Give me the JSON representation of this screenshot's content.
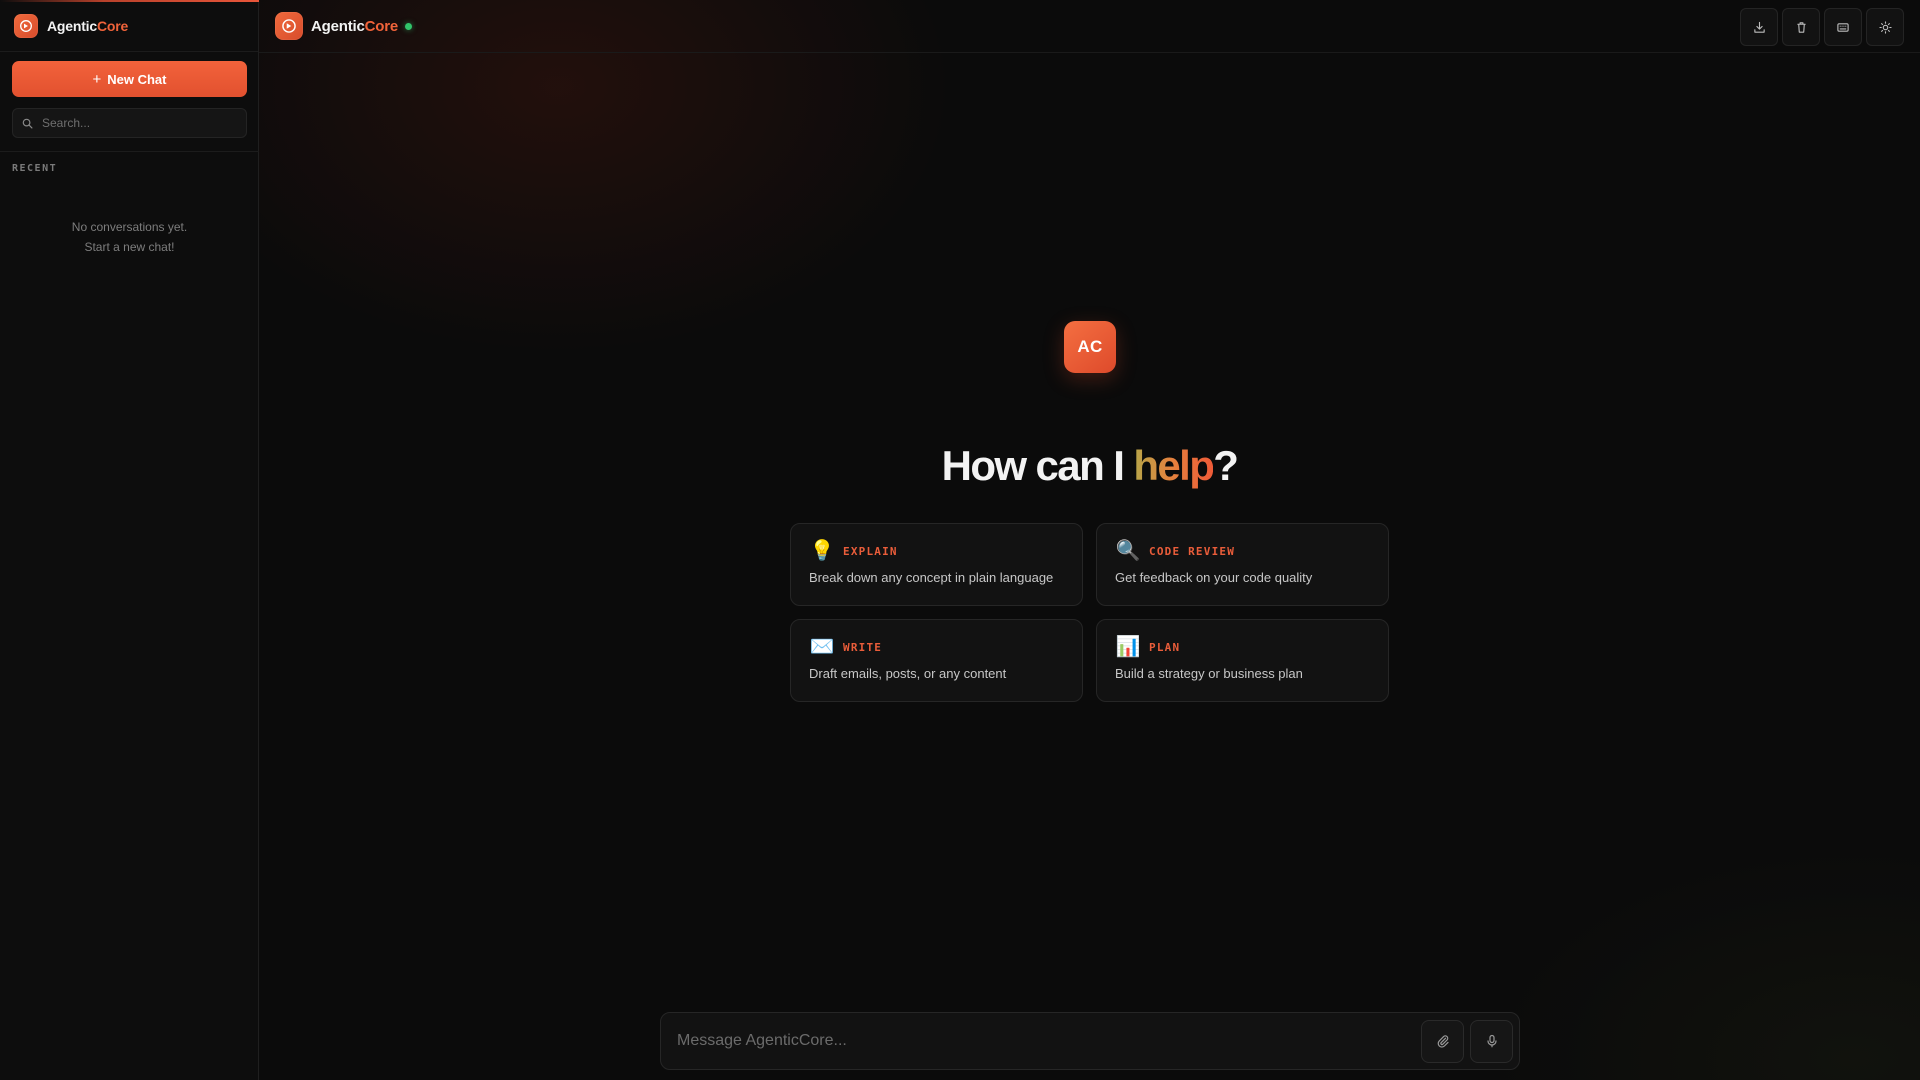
{
  "app": {
    "name_part1": "Agentic",
    "name_part2": "Core",
    "status": "online"
  },
  "sidebar": {
    "new_chat_label": "New Chat",
    "search_placeholder": "Search...",
    "recent_label": "RECENT",
    "empty_line1": "No conversations yet.",
    "empty_line2": "Start a new chat!"
  },
  "topbar": {
    "actions": [
      {
        "name": "download-icon"
      },
      {
        "name": "trash-icon"
      },
      {
        "name": "keyboard-icon"
      },
      {
        "name": "sun-icon"
      }
    ]
  },
  "hero": {
    "badge": "AC",
    "title_before": "How can I ",
    "title_highlight": "help",
    "title_after": "?"
  },
  "suggestions": [
    {
      "icon": "💡",
      "icon_name": "lightbulb-icon",
      "label": "EXPLAIN",
      "desc": "Break down any concept in plain language"
    },
    {
      "icon": "🔍",
      "icon_name": "magnifier-icon",
      "label": "CODE REVIEW",
      "desc": "Get feedback on your code quality"
    },
    {
      "icon": "✉️",
      "icon_name": "envelope-icon",
      "label": "WRITE",
      "desc": "Draft emails, posts, or any content"
    },
    {
      "icon": "📊",
      "icon_name": "bar-chart-icon",
      "label": "PLAN",
      "desc": "Build a strategy or business plan"
    }
  ],
  "composer": {
    "placeholder": "Message AgenticCore...",
    "value": ""
  },
  "colors": {
    "accent": "#f0633a",
    "background": "#0b0b0b",
    "status_green": "#31c46a"
  }
}
